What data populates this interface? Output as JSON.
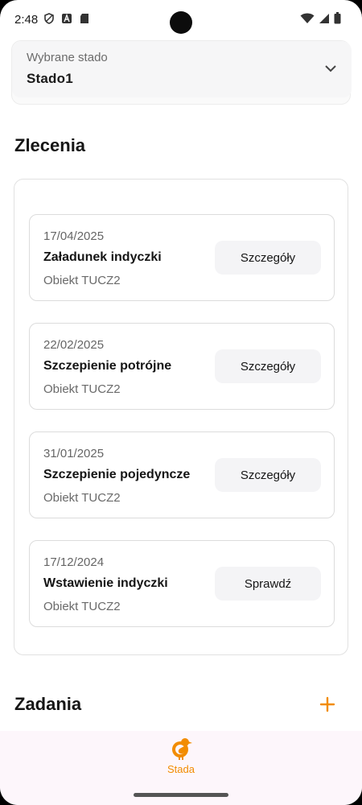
{
  "status_bar": {
    "time": "2:48",
    "left_icons": [
      "shield-icon",
      "a-icon",
      "sd-card-icon"
    ],
    "right_icons": [
      "wifi-icon",
      "signal-icon",
      "battery-icon"
    ]
  },
  "herd_selector": {
    "label": "Wybrane stado",
    "value": "Stado1",
    "icon": "chevron-down-icon"
  },
  "orders": {
    "title": "Zlecenia",
    "items": [
      {
        "date": "17/04/2025",
        "name": "Załadunek indyczki",
        "object": "Obiekt TUCZ2",
        "action": "Szczegóły"
      },
      {
        "date": "22/02/2025",
        "name": "Szczepienie potrójne",
        "object": "Obiekt TUCZ2",
        "action": "Szczegóły"
      },
      {
        "date": "31/01/2025",
        "name": "Szczepienie pojedyncze",
        "object": "Obiekt TUCZ2",
        "action": "Szczegóły"
      },
      {
        "date": "17/12/2024",
        "name": "Wstawienie indyczki",
        "object": "Obiekt TUCZ2",
        "action": "Sprawdź"
      }
    ]
  },
  "tasks": {
    "title": "Zadania",
    "add_icon": "plus-icon"
  },
  "bottom_nav": {
    "items": [
      {
        "label": "Stada",
        "icon": "turkey-icon",
        "active": true
      }
    ]
  },
  "colors": {
    "accent": "#f28c00",
    "text": "#151515",
    "muted": "#6a6a6a",
    "button_bg": "#f4f4f6",
    "nav_bg": "#fdf6fb"
  }
}
